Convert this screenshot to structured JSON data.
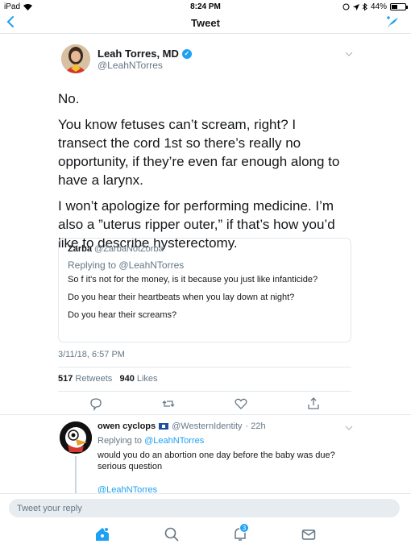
{
  "status_bar": {
    "device": "iPad",
    "time": "8:24 PM",
    "battery": "44%",
    "battery_level": 0.44
  },
  "nav": {
    "title": "Tweet",
    "back_icon": "chevron-left-icon",
    "compose_icon": "compose-tweet-icon"
  },
  "tweet": {
    "author_name": "Leah Torres, MD",
    "author_handle": "@LeahNTorres",
    "paragraphs": [
      "No.",
      "You know fetuses can’t scream, right? I transect the cord 1st so there’s really no opportunity, if they’re even far enough along to have a larynx.",
      "I won’t apologize for performing medicine. I’m also a ”uterus ripper outer,” if that’s how you’d like to describe hysterectomy."
    ],
    "timestamp": "3/11/18, 6:57 PM",
    "retweets_count": "517",
    "retweets_label": "Retweets",
    "likes_count": "940",
    "likes_label": "Likes"
  },
  "quote": {
    "name": "Zarba",
    "handle": "@ZarbaNotZorba",
    "replying_prefix": "Replying to",
    "replying_to": "@LeahNTorres",
    "lines": [
      "So f it's not for the money, is it because you just like infanticide?",
      "Do you hear their heartbeats when you lay down at night?",
      "Do you hear their screams?"
    ]
  },
  "reply": {
    "name": "owen cyclops",
    "handle": "@WesternIdentity",
    "time": "· 22h",
    "replying_prefix": "Replying to",
    "replying_to": "@LeahNTorres",
    "text": "would you do an abortion one day before the baby was due? serious question",
    "cut_text": "@LeahNTorres"
  },
  "reply_bar": {
    "placeholder": "Tweet your reply"
  },
  "tab_bar": {
    "notification_count": "3"
  },
  "colors": {
    "accent": "#1da1f2",
    "secondary_text": "#657786",
    "border": "#e1e8ed"
  }
}
